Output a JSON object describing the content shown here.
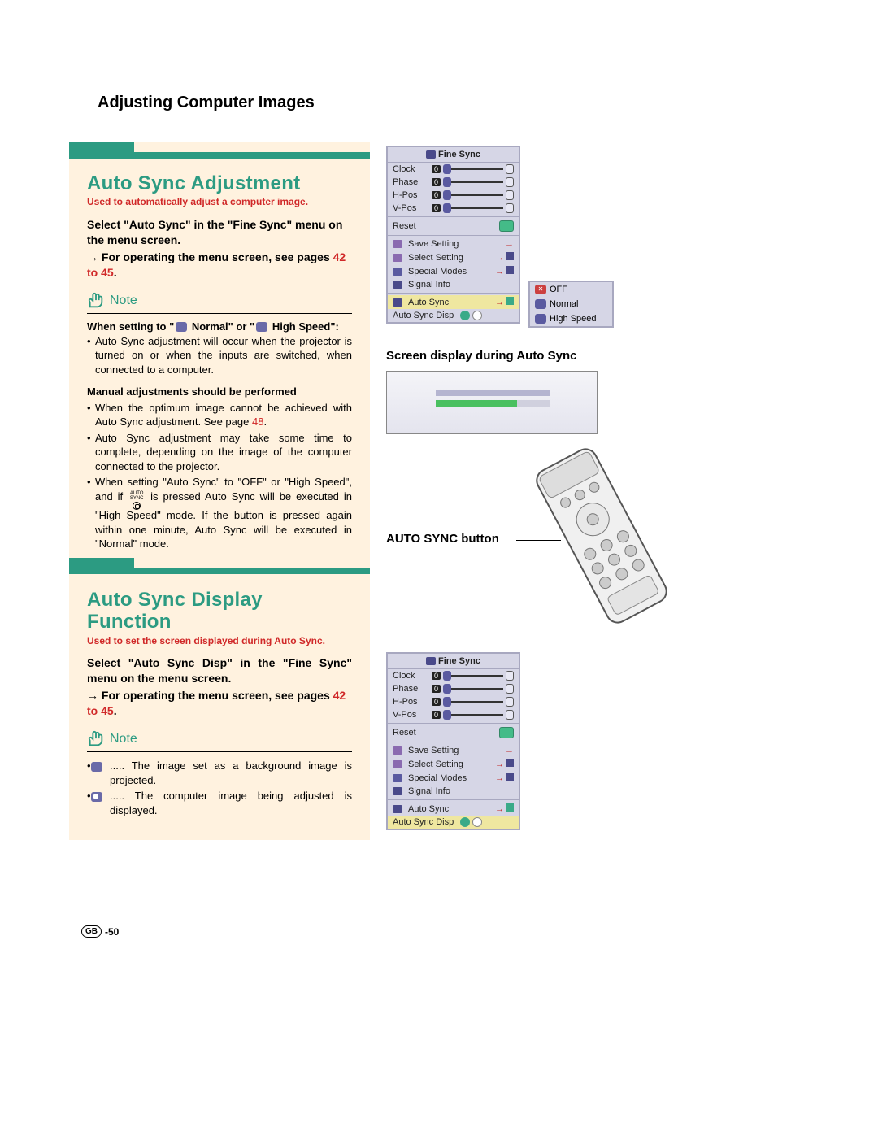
{
  "page": {
    "title": "Adjusting Computer Images",
    "page_number_prefix": "GB",
    "page_number": "-50"
  },
  "section1": {
    "title": "Auto Sync Adjustment",
    "subtitle": "Used to automatically adjust a computer image.",
    "select_line": "Select \"Auto Sync\" in the \"Fine Sync\" menu on the menu screen.",
    "arrow_line_a": "→ For operating the menu screen, see pages ",
    "arrow_pages": "42 to 45",
    "arrow_line_b": ".",
    "note_label": "Note",
    "when_setting_a": "When setting to \"",
    "when_setting_b": " Normal\" or \"",
    "when_setting_c": " High Speed\":",
    "bullet1": "Auto Sync adjustment will occur when the projector is turned on or when the inputs are switched, when connected to a computer.",
    "manual_heading": "Manual adjustments should be performed",
    "bullet2_a": "When the optimum image cannot be achieved with Auto Sync adjustment. See page ",
    "bullet2_page": "48",
    "bullet2_b": ".",
    "bullet3": "Auto Sync adjustment may take some time to complete, depending on the image of the computer connected to the projector.",
    "bullet4_a": "When setting \"Auto Sync\" to \"OFF\" or \"High Speed\", and if ",
    "bullet4_autosync": "AUTO SYNC",
    "bullet4_b": " is pressed Auto Sync will be executed in \"High Speed\" mode. If the button is pressed again within one minute, Auto Sync will be executed in \"Normal\" mode."
  },
  "section2": {
    "title": "Auto Sync Display Function",
    "subtitle": "Used to set the screen displayed during Auto Sync.",
    "select_line": "Select \"Auto Sync Disp\" in the \"Fine Sync\" menu on the menu screen.",
    "arrow_line_a": "→ For operating the menu screen, see pages ",
    "arrow_pages": "42 to 45",
    "arrow_line_b": ".",
    "note_label": "Note",
    "disp_bullet1": "..... The image set as a background image is projected.",
    "disp_bullet2": "..... The computer image being adjusted is displayed."
  },
  "menus": {
    "title": "Fine Sync",
    "rows": {
      "clock": "Clock",
      "phase": "Phase",
      "hpos": "H-Pos",
      "vpos": "V-Pos",
      "reset": "Reset",
      "save": "Save Setting",
      "select": "Select Setting",
      "special": "Special Modes",
      "signal": "Signal Info",
      "autosync": "Auto Sync",
      "autosyncdisp": "Auto Sync Disp"
    },
    "val0": "0",
    "popup": {
      "off": "OFF",
      "normal": "Normal",
      "high": "High Speed"
    }
  },
  "right": {
    "caption1": "Screen display during Auto Sync",
    "caption2": "AUTO SYNC button"
  }
}
